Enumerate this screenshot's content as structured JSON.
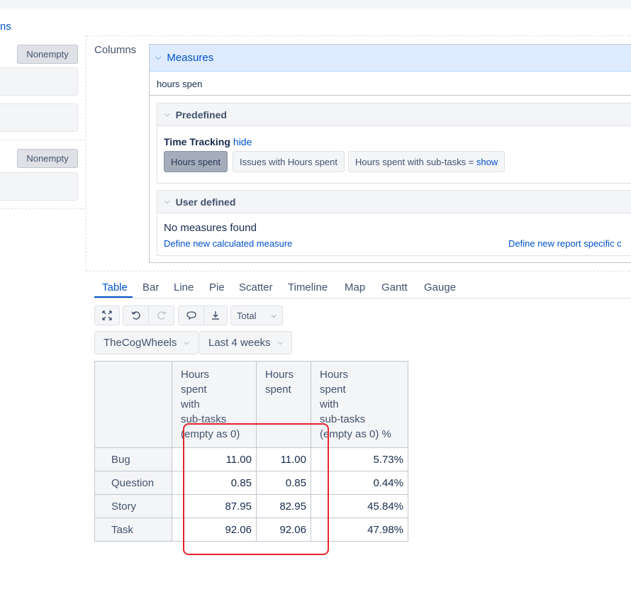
{
  "left_panel": {
    "columns_link": "ns",
    "nonempty_1": "Nonempty",
    "nonempty_2": "Nonempty"
  },
  "columns": {
    "label": "Columns",
    "measures": {
      "title": "Measures",
      "search_value": "hours spen",
      "predefined": {
        "title": "Predefined",
        "group_label": "Time Tracking",
        "group_toggle": "hide",
        "items": [
          {
            "label": "Hours spent",
            "selected": true
          },
          {
            "label": "Issues with Hours spent",
            "selected": false
          },
          {
            "label": "Hours spent with sub-tasks",
            "suffix": "=",
            "action": "show",
            "selected": false
          }
        ]
      },
      "user_defined": {
        "title": "User defined",
        "empty_text": "No measures found",
        "define_calc": "Define new calculated measure",
        "define_report": "Define new report specific c"
      }
    }
  },
  "chart_tabs": [
    "Table",
    "Bar",
    "Line",
    "Pie",
    "Scatter",
    "Timeline",
    "Map",
    "Gantt",
    "Gauge"
  ],
  "active_tab": "Table",
  "toolbar": {
    "icons": [
      "expand-icon",
      "undo-icon",
      "redo-icon",
      "comment-icon",
      "export-icon"
    ],
    "total_label": "Total"
  },
  "filters": {
    "project": "TheCogWheels",
    "period": "Last 4 weeks"
  },
  "table": {
    "headers": {
      "col1": [
        "Hours",
        "spent",
        "with",
        "sub-tasks",
        "(empty as 0)"
      ],
      "col2": [
        "Hours",
        "spent"
      ],
      "col3": [
        "Hours",
        "spent",
        "with",
        "sub-tasks",
        "(empty as 0) %"
      ]
    },
    "rows": [
      {
        "label": "Bug",
        "v1": "11.00",
        "v2": "11.00",
        "v3": "5.73%"
      },
      {
        "label": "Question",
        "v1": "0.85",
        "v2": "0.85",
        "v3": "0.44%"
      },
      {
        "label": "Story",
        "v1": "87.95",
        "v2": "82.95",
        "v3": "45.84%"
      },
      {
        "label": "Task",
        "v1": "92.06",
        "v2": "92.06",
        "v3": "47.98%"
      }
    ]
  },
  "colors": {
    "accent": "#0052cc",
    "highlight": "#e5232b"
  }
}
